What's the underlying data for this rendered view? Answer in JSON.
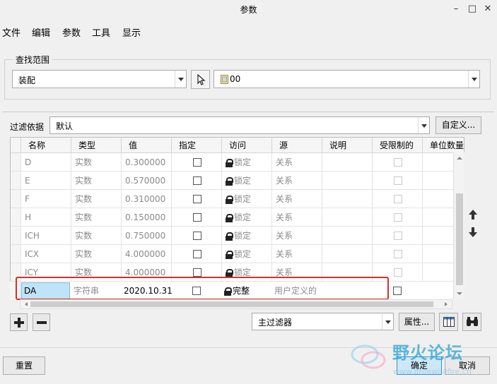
{
  "window": {
    "title": "参数",
    "min_icon": "minimize-icon",
    "max_icon": "maximize-icon",
    "close_icon": "close-icon"
  },
  "menu": [
    "文件",
    "编辑",
    "参数",
    "工具",
    "显示"
  ],
  "search_scope": {
    "legend": "查找范围",
    "scope_value": "装配",
    "select_icon": "cursor-arrow-icon",
    "model_value": "00",
    "model_icon": "part-icon"
  },
  "filter": {
    "label": "过滤依据",
    "value": "默认",
    "custom_button": "自定义..."
  },
  "table": {
    "columns": [
      "名称",
      "类型",
      "值",
      "指定",
      "访问",
      "源",
      "说明",
      "受限制的",
      "单位数量"
    ],
    "rows": [
      {
        "name": "D",
        "type": "实数",
        "value": "0.300000",
        "access": "锁定",
        "source": "关系"
      },
      {
        "name": "E",
        "type": "实数",
        "value": "0.570000",
        "access": "锁定",
        "source": "关系"
      },
      {
        "name": "F",
        "type": "实数",
        "value": "0.310000",
        "access": "锁定",
        "source": "关系"
      },
      {
        "name": "H",
        "type": "实数",
        "value": "0.150000",
        "access": "锁定",
        "source": "关系"
      },
      {
        "name": "ICH",
        "type": "实数",
        "value": "0.750000",
        "access": "锁定",
        "source": "关系"
      },
      {
        "name": "ICX",
        "type": "实数",
        "value": "4.000000",
        "access": "锁定",
        "source": "关系"
      },
      {
        "name": "ICY",
        "type": "实数",
        "value": "4.000000",
        "access": "锁定",
        "source": "关系"
      }
    ],
    "selected_row": {
      "name": "DA",
      "type": "字符串",
      "value": "2020.10.31",
      "access": "完整",
      "source": "用户定义的"
    }
  },
  "side_icons": {
    "up": "arrow-up-icon",
    "down": "arrow-down-icon"
  },
  "bottom_toolbar": {
    "add_icon": "plus-icon",
    "remove_icon": "minus-icon",
    "main_filter": "主过滤器",
    "properties_button": "属性...",
    "table_icon": "table-columns-icon",
    "find_icon": "binoculars-icon"
  },
  "footer": {
    "reset": "重置",
    "ok": "确定",
    "cancel": "取消"
  },
  "watermark": {
    "text": "野火论坛",
    "url": "www.proewildfire.cn"
  },
  "colors": {
    "highlight": "#d4302c",
    "selected_cell": "#bfe3f7",
    "ok_button": "#cce8f7"
  }
}
